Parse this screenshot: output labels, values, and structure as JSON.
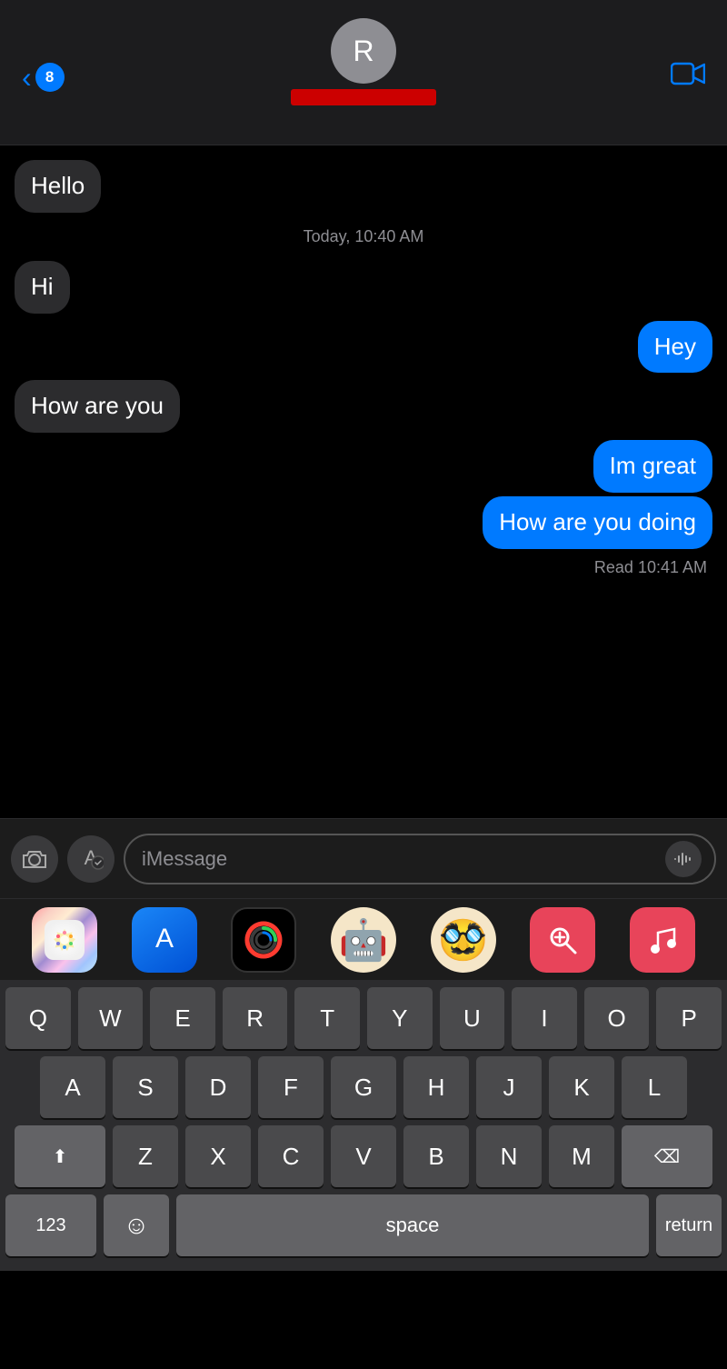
{
  "header": {
    "back_label": "8",
    "avatar_initial": "R",
    "video_icon": "📹"
  },
  "messages": [
    {
      "id": "msg1",
      "text": "Hello",
      "type": "received"
    },
    {
      "id": "divider1",
      "text": "Today, 10:40 AM",
      "type": "divider"
    },
    {
      "id": "msg2",
      "text": "Hi",
      "type": "received"
    },
    {
      "id": "msg3",
      "text": "Hey",
      "type": "sent"
    },
    {
      "id": "msg4",
      "text": "How are you",
      "type": "received"
    },
    {
      "id": "msg5",
      "text": "Im great",
      "type": "sent"
    },
    {
      "id": "msg6",
      "text": "How are you doing",
      "type": "sent"
    },
    {
      "id": "read1",
      "text": "Read 10:41 AM",
      "type": "read"
    }
  ],
  "input": {
    "placeholder": "iMessage"
  },
  "app_icons": [
    {
      "id": "photos",
      "label": "🌸"
    },
    {
      "id": "appstore",
      "label": "🅰"
    },
    {
      "id": "activity",
      "label": "⬤"
    },
    {
      "id": "memoji1",
      "label": "🤖"
    },
    {
      "id": "memoji2",
      "label": "🥸"
    },
    {
      "id": "websearch",
      "label": "🔍"
    },
    {
      "id": "music",
      "label": "♪"
    }
  ],
  "keyboard": {
    "rows": [
      [
        "Q",
        "W",
        "E",
        "R",
        "T",
        "Y",
        "U",
        "I",
        "O",
        "P"
      ],
      [
        "A",
        "S",
        "D",
        "F",
        "G",
        "H",
        "J",
        "K",
        "L"
      ],
      [
        "Z",
        "X",
        "C",
        "V",
        "B",
        "N",
        "M"
      ]
    ],
    "shift_label": "⬆",
    "delete_label": "⌫",
    "numbers_label": "123",
    "emoji_label": "☺",
    "space_label": "space",
    "return_label": "return"
  }
}
